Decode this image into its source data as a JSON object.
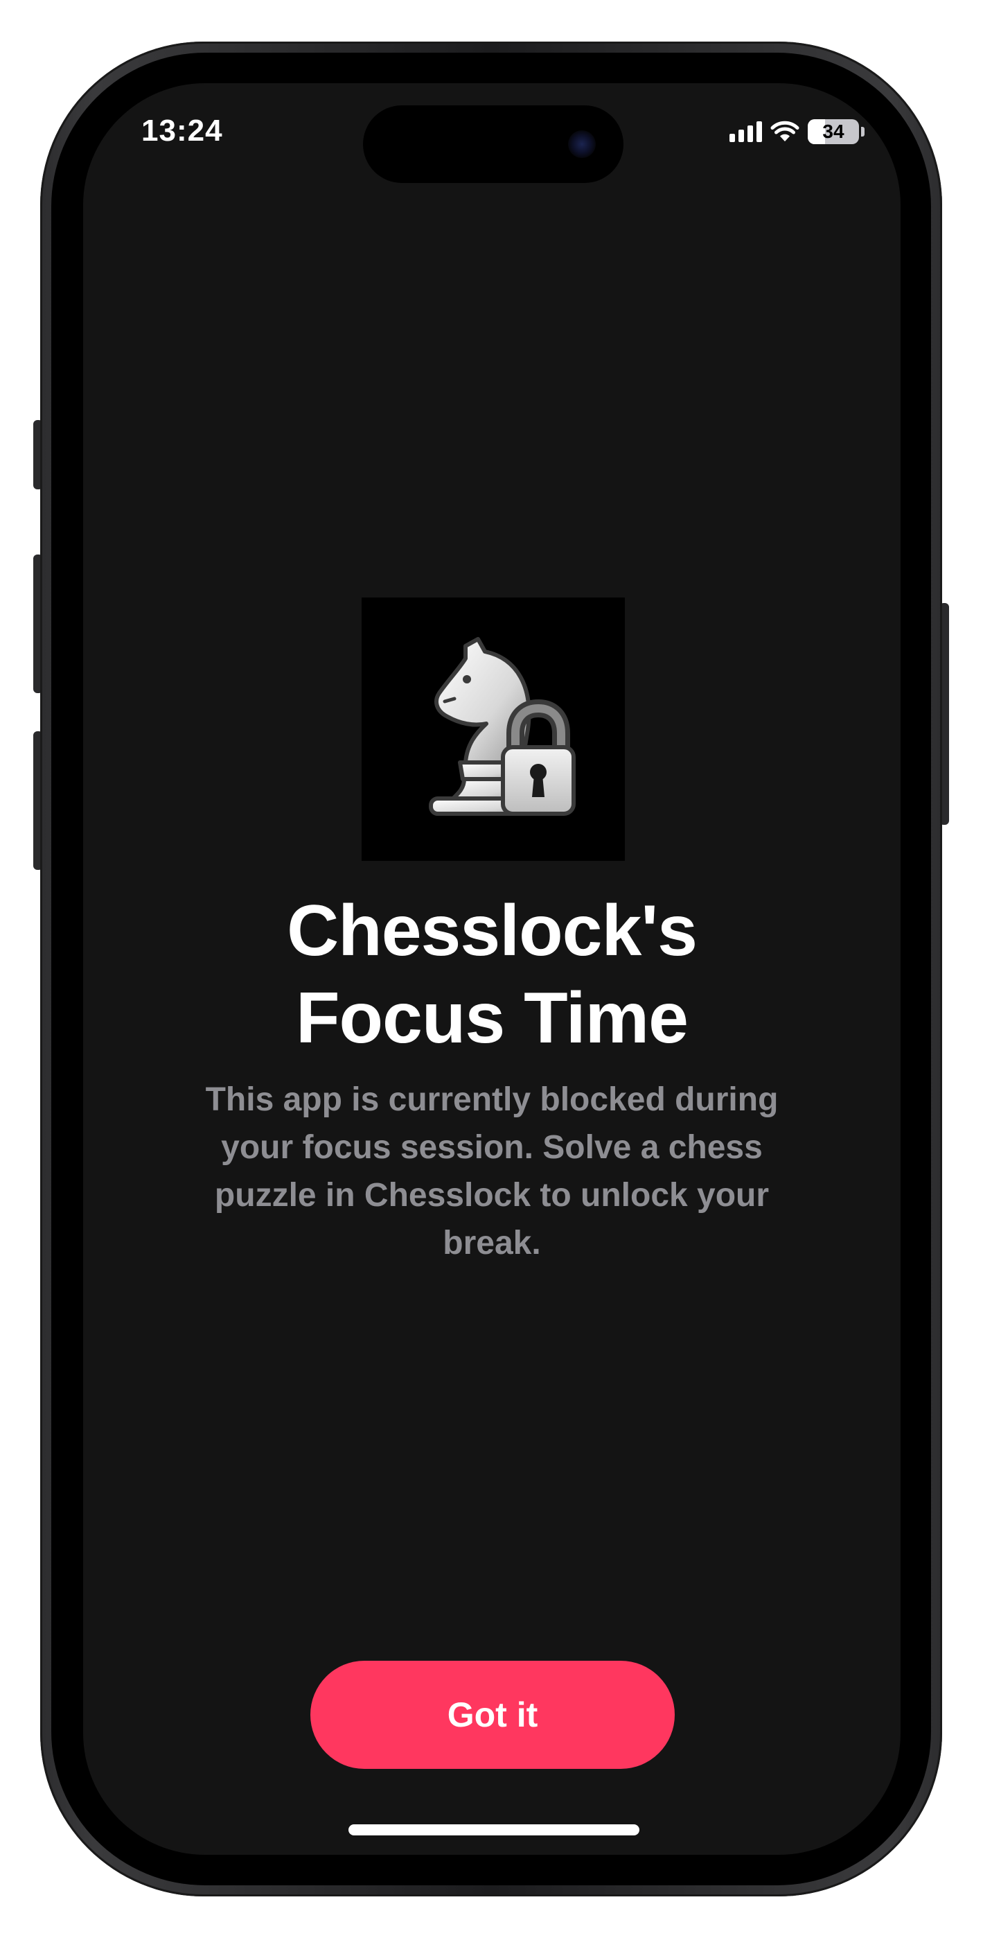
{
  "status_bar": {
    "time": "13:24",
    "battery_level": "34",
    "battery_fraction": 0.34,
    "signal_bars": 4,
    "icons": [
      "signal-icon",
      "wifi-icon",
      "battery-icon"
    ]
  },
  "main": {
    "icon": "chess-knight-lock-icon",
    "title_line1": "Chesslock's",
    "title_line2": "Focus Time",
    "message": "This app is currently blocked during your focus session. Solve a chess puzzle in Chesslock to unlock your break."
  },
  "actions": {
    "primary_label": "Got it"
  },
  "colors": {
    "background": "#141414",
    "accent": "#ff375f",
    "title": "#ffffff",
    "message": "#8e8e93"
  }
}
